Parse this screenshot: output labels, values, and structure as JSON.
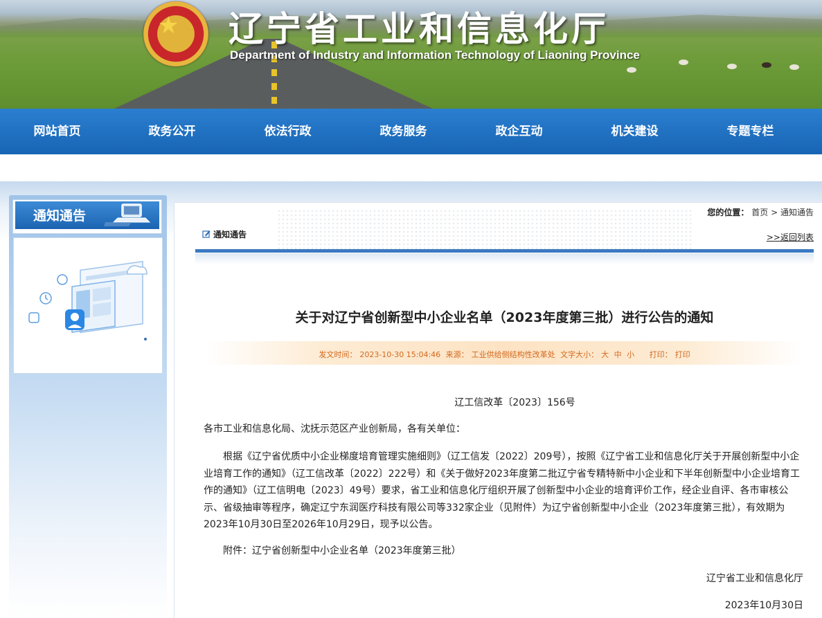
{
  "header": {
    "title_cn": "辽宁省工业和信息化厅",
    "title_en": "Department of Industry and Information Technology of Liaoning Province"
  },
  "nav": {
    "items": [
      "网站首页",
      "政务公开",
      "依法行政",
      "政务服务",
      "政企互动",
      "机关建设",
      "专题专栏"
    ]
  },
  "sidebar": {
    "title": "通知通告"
  },
  "breadcrumb": {
    "prefix": "您的位置：",
    "home": "首页",
    "sep": ">",
    "current": "通知通告"
  },
  "section": {
    "label": "通知通告",
    "back": ">>返回列表"
  },
  "article": {
    "title": "关于对辽宁省创新型中小企业名单（2023年度第三批）进行公告的通知",
    "meta": {
      "time_label": "发文时间：",
      "time": "2023-10-30 15:04:46",
      "source_label": "来源：",
      "source": "工业供给侧结构性改革处",
      "size_label": "文字大小：",
      "size_large": "大",
      "size_mid": "中",
      "size_small": "小",
      "print_label": "打印：",
      "print": "打印"
    },
    "doc_no": "辽工信改革〔2023〕156号",
    "salutation": "各市工业和信息化局、沈抚示范区产业创新局，各有关单位：",
    "body": "根据《辽宁省优质中小企业梯度培育管理实施细则》（辽工信发〔2022〕209号），按照《辽宁省工业和信息化厅关于开展创新型中小企业培育工作的通知》（辽工信改革〔2022〕222号）和《关于做好2023年度第二批辽宁省专精特新中小企业和下半年创新型中小企业培育工作的通知》（辽工信明电〔2023〕49号）要求，省工业和信息化厅组织开展了创新型中小企业的培育评价工作，经企业自评、各市审核公示、省级抽审等程序，确定辽宁东润医疗科技有限公司等332家企业（见附件）为辽宁省创新型中小企业（2023年度第三批），有效期为2023年10月30日至2026年10月29日，现予以公告。",
    "attachment": "附件：辽宁省创新型中小企业名单（2023年度第三批）",
    "signature": "辽宁省工业和信息化厅",
    "date": "2023年10月30日"
  }
}
